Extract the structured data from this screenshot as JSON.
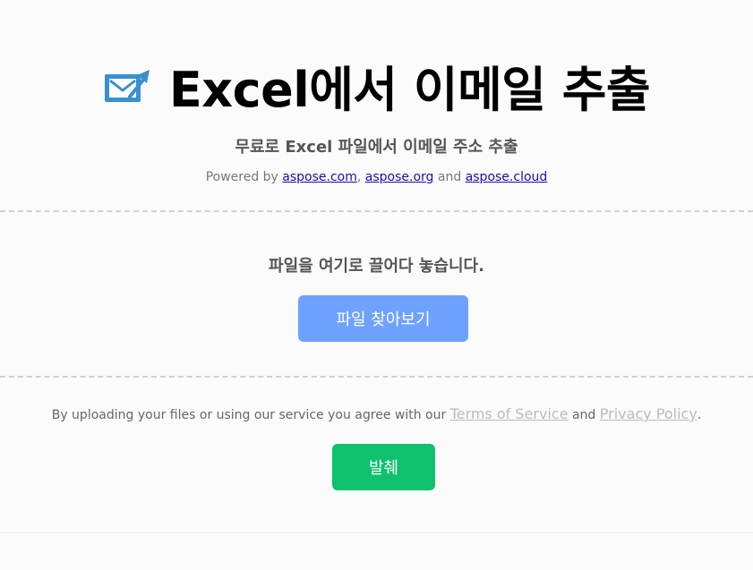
{
  "header": {
    "title": "Excel에서 이메일 추출",
    "subtitle": "무료로 Excel 파일에서 이메일 주소 추출",
    "powered_prefix": "Powered by ",
    "links": [
      "aspose.com",
      "aspose.org",
      "aspose.cloud"
    ],
    "sep_comma": ", ",
    "sep_and": " and ",
    "logo_icon": "mail-upload-icon"
  },
  "upload": {
    "drop_text": "파일을 여기로 끌어다 놓습니다.",
    "browse_label": "파일 찾아보기"
  },
  "terms": {
    "prefix": "By uploading your files or using our service you agree with our ",
    "terms_link": "Terms of Service",
    "and": " and ",
    "privacy_link": "Privacy Policy",
    "suffix": "."
  },
  "actions": {
    "extract_label": "발췌"
  },
  "colors": {
    "browse_button": "#6fa1ff",
    "extract_button": "#0ec16c",
    "logo_blue": "#3a8fd0"
  }
}
